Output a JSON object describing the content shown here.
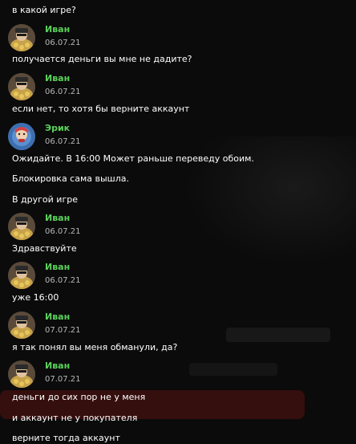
{
  "chat": {
    "colors": {
      "background": "#0b0b0b",
      "author_name": "#5bd15b",
      "text": "#ffffff",
      "date": "#b8b8b8"
    },
    "messages": [
      {
        "type": "text",
        "text": "в какой игре?"
      },
      {
        "type": "author",
        "name": "Иван",
        "date": "06.07.21",
        "avatar": "ivan-avatar"
      },
      {
        "type": "text",
        "text": "получается деньги вы мне не дадите?"
      },
      {
        "type": "author",
        "name": "Иван",
        "date": "06.07.21",
        "avatar": "ivan-avatar"
      },
      {
        "type": "text",
        "text": "если нет, то хотя бы верните аккаунт"
      },
      {
        "type": "author",
        "name": "Эрик",
        "date": "06.07.21",
        "avatar": "erik-avatar"
      },
      {
        "type": "text",
        "text": "Ожидайте. В 16:00 Может раньше переведу обоим."
      },
      {
        "type": "text",
        "text": "Блокировка сама вышла."
      },
      {
        "type": "text",
        "text": "В другой игре"
      },
      {
        "type": "author",
        "name": "Иван",
        "date": "06.07.21",
        "avatar": "ivan-avatar"
      },
      {
        "type": "text",
        "text": "Здравствуйте"
      },
      {
        "type": "author",
        "name": "Иван",
        "date": "06.07.21",
        "avatar": "ivan-avatar"
      },
      {
        "type": "text",
        "text": "уже 16:00"
      },
      {
        "type": "author",
        "name": "Иван",
        "date": "07.07.21",
        "avatar": "ivan-avatar"
      },
      {
        "type": "text",
        "text": "я так понял вы меня обманули, да?"
      },
      {
        "type": "author",
        "name": "Иван",
        "date": "07.07.21",
        "avatar": "ivan-avatar"
      },
      {
        "type": "text",
        "text": "деньги до сих пор не у меня"
      },
      {
        "type": "text",
        "text": "и аккаунт не у покупателя"
      },
      {
        "type": "text",
        "text": "верните тогда аккаунт"
      }
    ]
  }
}
